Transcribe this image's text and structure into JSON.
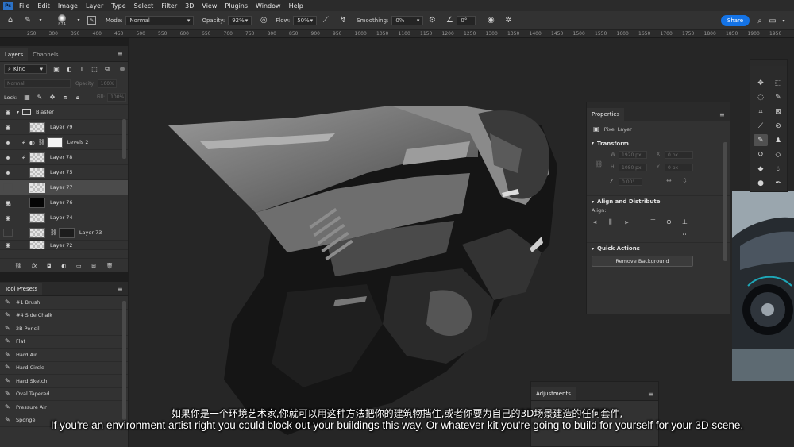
{
  "menubar": {
    "logo": "Ps",
    "items": [
      "File",
      "Edit",
      "Image",
      "Layer",
      "Type",
      "Select",
      "Filter",
      "3D",
      "View",
      "Plugins",
      "Window",
      "Help"
    ]
  },
  "options": {
    "brush_size": "874",
    "mode_label": "Mode:",
    "mode_value": "Normal",
    "opacity_label": "Opacity:",
    "opacity_value": "92%",
    "flow_label": "Flow:",
    "flow_value": "50%",
    "smoothing_label": "Smoothing:",
    "smoothing_value": "0%",
    "angle_value": "0°",
    "share_label": "Share"
  },
  "ruler": {
    "ticks": [
      "250",
      "300",
      "350",
      "400",
      "450",
      "500",
      "550",
      "600",
      "650",
      "700",
      "750",
      "800",
      "850",
      "900",
      "950",
      "1000",
      "1050",
      "1100",
      "1150",
      "1200",
      "1250",
      "1300",
      "1350",
      "1400",
      "1450",
      "1500",
      "1550",
      "1600",
      "1650",
      "1700",
      "1750",
      "1800",
      "1850",
      "1900",
      "1950"
    ]
  },
  "layers_panel": {
    "tabs": [
      "Layers",
      "Channels"
    ],
    "kind_label": "Kind",
    "blend_mode": "Normal",
    "opacity_label": "Opacity:",
    "opacity_value": "100%",
    "lock_label": "Lock:",
    "fill_label": "Fill:",
    "fill_value": "100%",
    "group_name": "Blaster",
    "layers": [
      {
        "name": "Layer 79",
        "thumb": "checker",
        "selected": false
      },
      {
        "name": "Levels 2",
        "thumb": "white",
        "selected": false
      },
      {
        "name": "Layer 78",
        "thumb": "checker",
        "selected": false
      },
      {
        "name": "Layer 75",
        "thumb": "checker",
        "selected": false
      },
      {
        "name": "Layer 77",
        "thumb": "checker",
        "selected": true
      },
      {
        "name": "Layer 76",
        "thumb": "black",
        "selected": false
      },
      {
        "name": "Layer 74",
        "thumb": "checker",
        "selected": false
      },
      {
        "name": "Layer 73",
        "thumb": "checker",
        "selected": false
      },
      {
        "name": "Layer 72",
        "thumb": "checker",
        "selected": false
      }
    ]
  },
  "tool_presets": {
    "title": "Tool Presets",
    "items": [
      "#1 Brush",
      "#4 Side Chalk",
      "2B Pencil",
      "Flat",
      "Hard Air",
      "Hard Circle",
      "Hard Sketch",
      "Oval Tapered",
      "Pressure Air",
      "Sponge"
    ]
  },
  "properties": {
    "title": "Properties",
    "layer_type": "Pixel Layer",
    "transform_title": "Transform",
    "w_label": "W",
    "w_value": "1920 px",
    "x_label": "X",
    "x_value": "0 px",
    "h_label": "H",
    "h_value": "1080 px",
    "y_label": "Y",
    "y_value": "0 px",
    "angle_value": "0.00°",
    "align_title": "Align and Distribute",
    "align_label": "Align:",
    "quick_title": "Quick Actions",
    "remove_bg": "Remove Background"
  },
  "adjustments": {
    "title": "Adjustments"
  },
  "subtitles": {
    "zh": "如果你是一个环境艺术家,你就可以用这种方法把你的建筑物挡住,或者你要为自己的3D场景建造的任何套件,",
    "en": "If you're an environment artist right you could block out your buildings this way. Or whatever kit you're going to build for yourself for your 3D scene."
  },
  "colors": {
    "accent": "#1473e6",
    "panel": "#323232",
    "canvas": "#262626"
  }
}
